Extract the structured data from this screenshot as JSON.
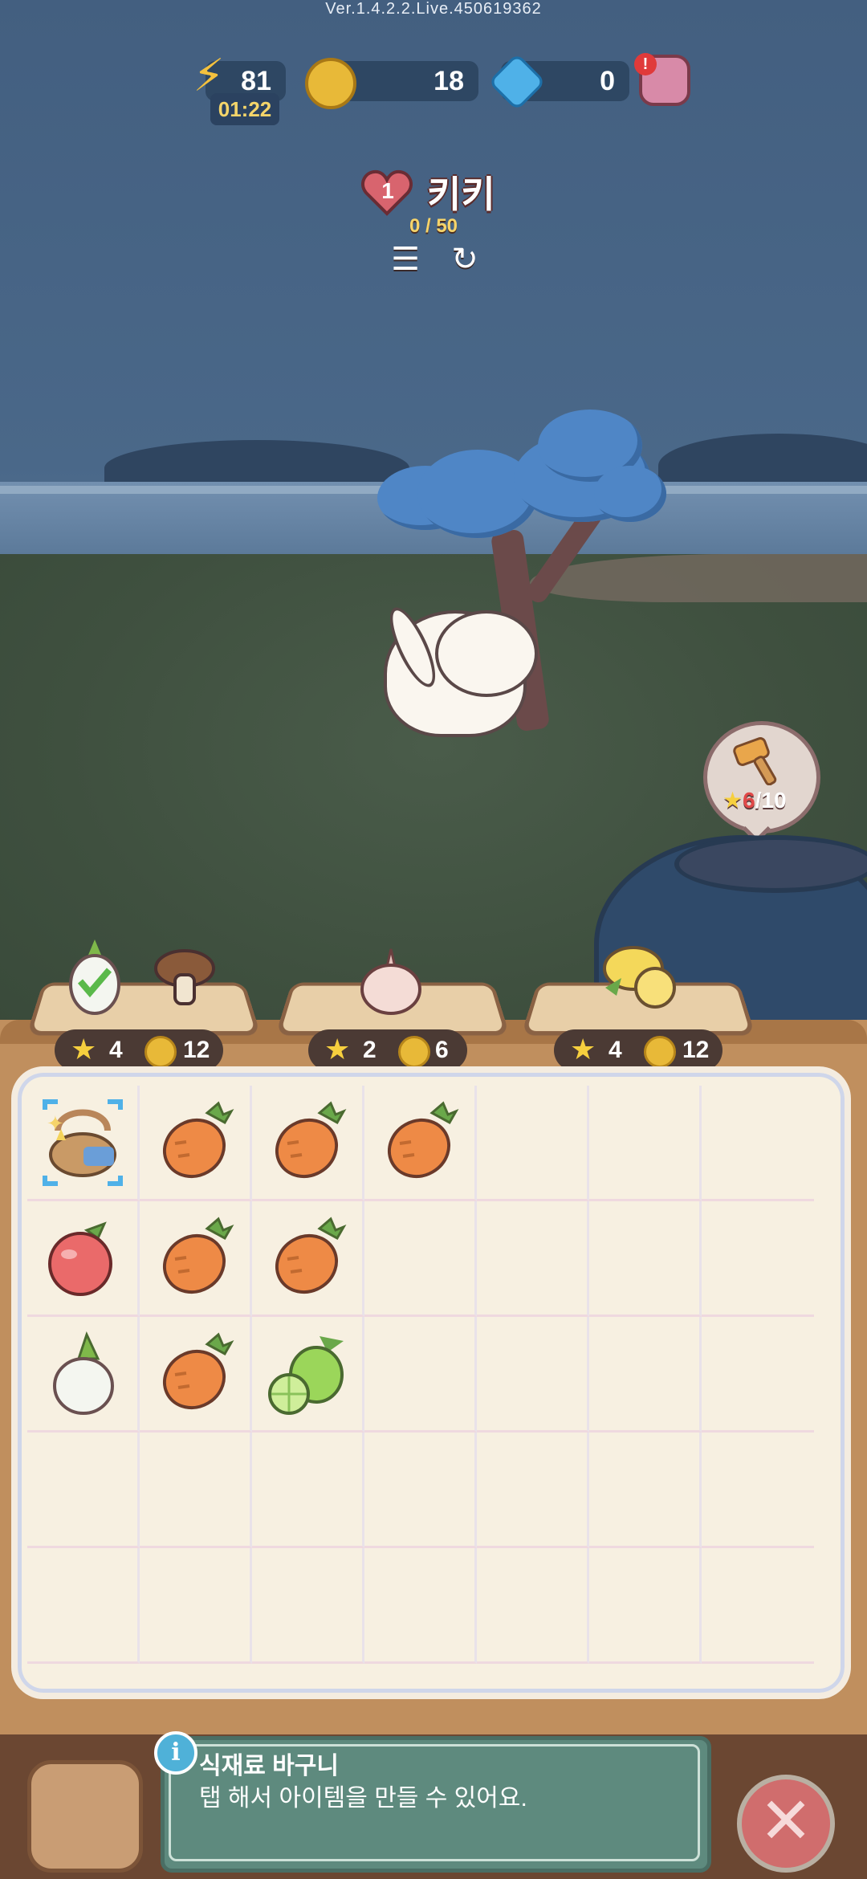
{
  "version": "Ver.1.4.2.2.Live.450619362",
  "resources": {
    "energy": {
      "icon": "lightning-icon",
      "value": "81",
      "timer": "01:22"
    },
    "coins": {
      "icon": "coin-icon",
      "value": "18"
    },
    "gems": {
      "icon": "gem-icon",
      "value": "0"
    },
    "shop": {
      "icon": "coin-purse-icon",
      "alert": "!"
    }
  },
  "customer": {
    "level": "1",
    "name": "키키",
    "progress": "0 / 50",
    "progress_fraction": 0.0
  },
  "toolbar_icons": [
    "list-icon",
    "refresh-icon"
  ],
  "tool_bubble": {
    "icon": "hammer-icon",
    "current": "6",
    "total": "/10"
  },
  "orders": [
    {
      "items": [
        "radish-icon",
        "mushroom-icon"
      ],
      "stars": "4",
      "coins": "12",
      "completed_item": "radish-icon"
    },
    {
      "items": [
        "garlic-icon"
      ],
      "stars": "2",
      "coins": "6"
    },
    {
      "items": [
        "lemon-icon"
      ],
      "stars": "4",
      "coins": "12"
    }
  ],
  "board": {
    "columns": 7,
    "rows": 5,
    "items": [
      [
        "basket-icon",
        "carrot-icon",
        "carrot-icon",
        "carrot-icon",
        "",
        "",
        ""
      ],
      [
        "apple-icon",
        "carrot-icon",
        "carrot-icon",
        "",
        "",
        "",
        ""
      ],
      [
        "radish-icon",
        "carrot-icon",
        "lime-icon",
        "",
        "",
        "",
        ""
      ],
      [
        "",
        "",
        "",
        "",
        "",
        "",
        ""
      ],
      [
        "",
        "",
        "",
        "",
        "",
        "",
        ""
      ]
    ]
  },
  "info_panel": {
    "icon": "info-icon",
    "icon_glyph": "i",
    "title": "식재료 바구니",
    "description": "탭 해서 아이템을 만들 수 있어요."
  },
  "bottom": {
    "bag_icon": "bag-icon",
    "close_icon": "close-icon",
    "close_glyph": "✕"
  },
  "colors": {
    "wood": "#c08f5e",
    "board": "#f7f0e1",
    "panel": "#5e8a7e",
    "close": "#d06d6d"
  }
}
